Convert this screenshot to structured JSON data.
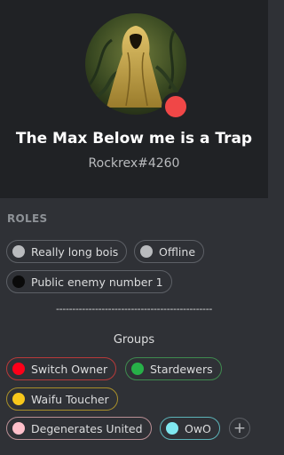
{
  "profile": {
    "display_name": "The Max Below me is a Trap",
    "tag": "Rockrex#4260",
    "status_color": "#f04747"
  },
  "roles_section": {
    "label": "ROLES",
    "roles": [
      {
        "label": "Really long bois",
        "color": "#b9bbbe"
      },
      {
        "label": "Offline",
        "color": "#b9bbbe"
      },
      {
        "label": "Public enemy number 1",
        "color": "#0a0a0a"
      }
    ]
  },
  "divider_text": "------------------------------------------------",
  "groups": {
    "label": "Groups",
    "roles": [
      {
        "label": "Switch Owner",
        "color": "#ff0019",
        "border": "#b83a3a"
      },
      {
        "label": "Stardewers",
        "color": "#27b048",
        "border": "#3f8a4f"
      },
      {
        "label": "Waifu Toucher",
        "color": "#f7c71b",
        "border": "#a88f2a"
      },
      {
        "label": "Degenerates United",
        "color": "#ffc0cb",
        "border": "#b98f95"
      },
      {
        "label": "OwO",
        "color": "#7fe8f0",
        "border": "#5cb3b8"
      }
    ]
  },
  "add_role_icon": "plus-icon"
}
